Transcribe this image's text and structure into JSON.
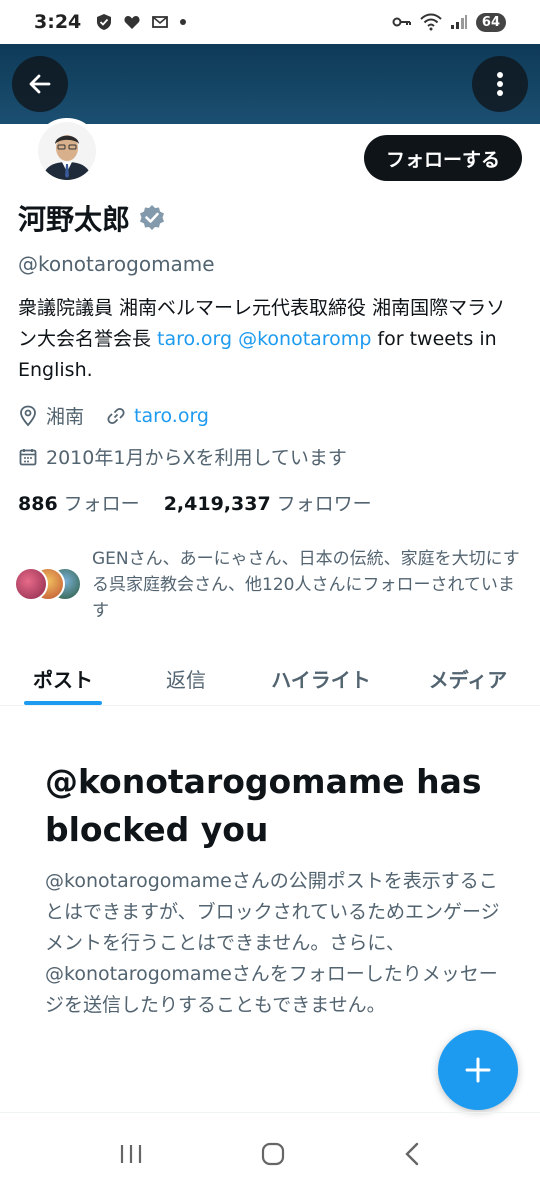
{
  "status_bar": {
    "time": "3:24",
    "battery": "64"
  },
  "profile": {
    "name": "河野太郎",
    "handle": "@konotarogomame",
    "follow_label": "フォローする",
    "bio_text": "衆議院議員 湘南ベルマーレ元代表取締役 湘南国際マラソン大会名誉会長 ",
    "bio_link1": "taro.org",
    "bio_link2": "@konotaromp",
    "bio_suffix": " for tweets in English.",
    "location": "湘南",
    "website": "taro.org",
    "joined": "2010年1月からXを利用しています",
    "following_count": "886",
    "following_label": "フォロー",
    "followers_count": "2,419,337",
    "followers_label": "フォロワー",
    "known_followers": "GENさん、あーにゃさん、日本の伝統、家庭を大切にする呉家庭教会さん、他120人さんにフォローされています"
  },
  "tabs": [
    {
      "label": "ポスト"
    },
    {
      "label": "返信"
    },
    {
      "label": "ハイライト"
    },
    {
      "label": "メディア"
    }
  ],
  "blocked": {
    "title": "@konotarogomame has blocked you",
    "body": "@konotarogomameさんの公開ポストを表示することはできますが、ブロックされているためエンゲージメントを行うことはできません。さらに、@konotarogomameさんをフォローしたりメッセージを送信したりすることもできません。"
  },
  "colors": {
    "accent": "#1d9bf0",
    "text": "#0f1419",
    "muted": "#536471"
  }
}
